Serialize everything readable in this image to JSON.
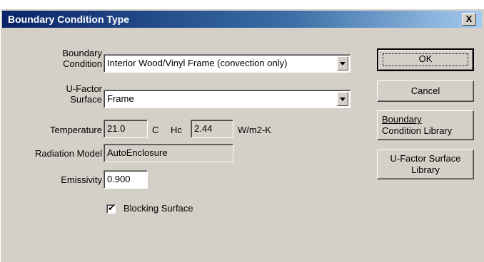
{
  "window": {
    "title": "Boundary Condition Type",
    "close_glyph": "X"
  },
  "form": {
    "boundary_condition": {
      "label_line1": "Boundary",
      "label_line2": "Condition",
      "value": "Interior Wood/Vinyl Frame (convection only)"
    },
    "ufactor_surface": {
      "label_line1": "U-Factor",
      "label_line2": "Surface",
      "value": "Frame"
    },
    "temperature": {
      "label": "Temperature",
      "value": "21.0",
      "unit": "C"
    },
    "hc": {
      "label": "Hc",
      "value": "2.44",
      "unit": "W/m2-K"
    },
    "radiation_model": {
      "label": "Radiation Model",
      "value": "AutoEnclosure"
    },
    "emissivity": {
      "label": "Emissivity",
      "value": "0.900"
    },
    "blocking_surface": {
      "label": "Blocking Surface",
      "checked": true,
      "check_glyph": "✔"
    }
  },
  "buttons": {
    "ok": "OK",
    "cancel": "Cancel",
    "boundary_library_line1": "Boundary",
    "boundary_library_line2": "Condition Library",
    "ufactor_library_line1": "U-Factor Surface",
    "ufactor_library_line2": "Library"
  },
  "icons": {
    "pointer": "arrow-right-icon"
  }
}
